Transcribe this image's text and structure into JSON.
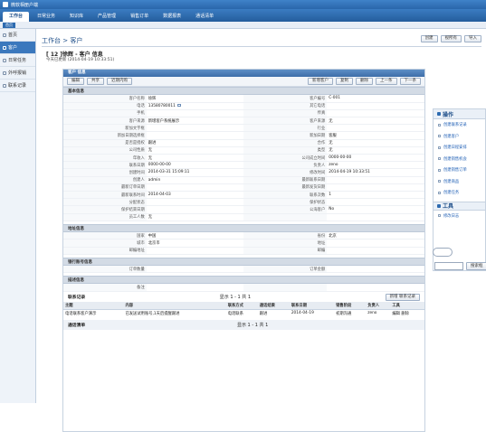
{
  "window": {
    "title": "微软相册户端"
  },
  "menu": {
    "items": [
      "工作台",
      "日常业务",
      "知识库",
      "产品管理",
      "销售订单",
      "数据报表",
      "通话清单"
    ]
  },
  "subbar": {
    "tag": "首页"
  },
  "sidebar": {
    "items": [
      "首页",
      "客户",
      "日常任务",
      "外呼报销",
      "联系记录"
    ]
  },
  "main": {
    "breadcrumb": "工作台 > 客户",
    "top_buttons": [
      "创建",
      "视所有",
      "导入"
    ],
    "record_title": "[ 12 ]徐辉 - 客户 信息",
    "record_subtitle": "今天已更新 (2014-04-19 10:33:51)"
  },
  "form": {
    "panel_title": "客户 信息",
    "toolbar_left": [
      "编辑",
      "共享",
      "近期内购"
    ],
    "toolbar_right": [
      "新增客户",
      "复制",
      "删除",
      "上一条",
      "下一条"
    ],
    "basic": {
      "title": "基本信息",
      "rows": [
        [
          "客户名称",
          "徐辉",
          "客户编号",
          "C-001"
        ],
        [
          "电话",
          "13580780011",
          "其它电话",
          ""
        ],
        [
          "手机",
          "",
          "传真",
          ""
        ],
        [
          "客户来源",
          "新增客户系统展示",
          "客户来源",
          "无"
        ],
        [
          "新加文字框",
          "",
          "行业",
          ""
        ],
        [
          "新加日期选择框",
          "",
          "新加日期",
          "客服"
        ],
        [
          "是否是授权",
          "跟进",
          "合作",
          "无"
        ],
        [
          "公司性质",
          "无",
          "类型",
          "无"
        ],
        [
          "年收入",
          "无",
          "公司成立时间",
          "0000-00-00"
        ],
        [
          "联系日期",
          "0000-00-00",
          "负责人",
          "zeno"
        ],
        [
          "创建时间",
          "2014-03-31 15:09:11",
          "修改时间",
          "2014-04-19 10:33:51"
        ],
        [
          "创建人",
          "admin",
          "最新联系日期",
          ""
        ],
        [
          "最新订单日期",
          "",
          "最新发货日期",
          ""
        ],
        [
          "最新联系时间",
          "2014-04-03",
          "联系次数",
          "1"
        ],
        [
          "分配状态",
          "",
          "保护状态",
          ""
        ],
        [
          "保护结束日期",
          "",
          "公海客户",
          "No"
        ],
        [
          "员工人数",
          "无",
          "",
          ""
        ]
      ]
    },
    "address": {
      "title": "地址信息",
      "rows": [
        [
          "国家",
          "中国",
          "省份",
          "北京"
        ],
        [
          "城市",
          "北京市",
          "地址",
          ""
        ],
        [
          "邮编地址",
          "",
          "邮编",
          ""
        ]
      ]
    },
    "bank": {
      "title": "银行账号信息",
      "rows": [
        [
          "订单数量",
          "",
          "订单金额",
          ""
        ]
      ]
    },
    "desc": {
      "title": "描述信息",
      "rows": [
        [
          "备注",
          "",
          "",
          ""
        ]
      ]
    },
    "contacts": {
      "title": "联系记录",
      "pager": "显示 1 - 1 共 1",
      "add_button": "新增 联系记录",
      "headers": [
        "主题",
        "内容",
        "联系方式",
        "通话结果",
        "联系日期",
        "销售阶段",
        "负责人",
        "工具"
      ],
      "rows": [
        [
          "电话联系客户演示",
          "已发送试用账号,1天后提醒跟进",
          "电话联系",
          "跟进",
          "2014-04-19",
          "初期沟通",
          "zeno",
          "编辑 删除"
        ]
      ]
    },
    "calls": {
      "title": "通话清单",
      "pager": "显示 1 - 1 共 1"
    }
  },
  "rightpanel": {
    "title": "操作",
    "items": [
      "创建联系记录",
      "创建客户",
      "创建日程安排",
      "创建销售机会",
      "创建销售订单",
      "创建商品",
      "创建任务"
    ],
    "tools_title": "工具",
    "tools_items": [
      "修改日志"
    ],
    "search_button": "搜索框"
  }
}
